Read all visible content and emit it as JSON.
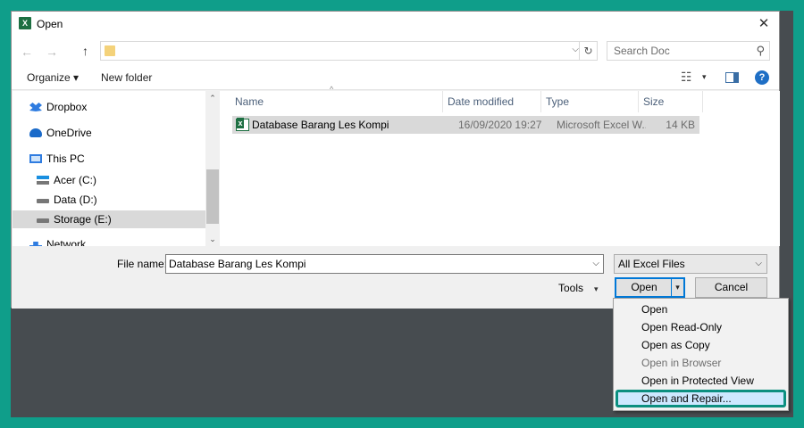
{
  "window": {
    "title": "Open",
    "app_icon": "X",
    "close": "✕"
  },
  "nav": {
    "back": "←",
    "forward": "→",
    "up": "↑",
    "address": "",
    "refresh": "↻",
    "dropdown": "⌵"
  },
  "search": {
    "placeholder": "Search Doc",
    "icon": "⚲"
  },
  "toolbar": {
    "organize": "Organize ▾",
    "new_folder": "New folder",
    "views": "☷",
    "views_caret": "▾",
    "help": "?"
  },
  "sidebar": {
    "items": [
      {
        "label": "Dropbox",
        "icon": "dropbox-icon"
      },
      {
        "label": "OneDrive",
        "icon": "onedrive-icon"
      },
      {
        "label": "This PC",
        "icon": "computer-icon"
      },
      {
        "label": "Acer (C:)",
        "icon": "windows-drive-icon"
      },
      {
        "label": "Data (D:)",
        "icon": "drive-icon"
      },
      {
        "label": "Storage (E:)",
        "icon": "drive-icon",
        "selected": true
      },
      {
        "label": "Network",
        "icon": "network-icon"
      }
    ]
  },
  "scrollbar": {
    "up": "⌃",
    "down": "⌄"
  },
  "columns": {
    "name": "Name",
    "date": "Date modified",
    "type": "Type",
    "size": "Size",
    "sort_caret": "^"
  },
  "files": [
    {
      "name": "Database Barang Les Kompi",
      "date": "16/09/2020 19:27",
      "type": "Microsoft Excel W...",
      "size": "14 KB"
    }
  ],
  "footer": {
    "file_name_label": "File name:",
    "file_name_value": "Database Barang Les Kompi",
    "filter": "All Excel Files",
    "tools": "Tools",
    "tools_caret": "▾",
    "open": "Open",
    "open_split": "▾",
    "cancel": "Cancel",
    "drop": "⌵"
  },
  "open_menu": {
    "items": [
      {
        "label": "Open",
        "enabled": true
      },
      {
        "label": "Open Read-Only",
        "enabled": true
      },
      {
        "label": "Open as Copy",
        "enabled": true
      },
      {
        "label": "Open in Browser",
        "enabled": false
      },
      {
        "label": "Open in Protected View",
        "enabled": true
      },
      {
        "label": "Open and Repair...",
        "enabled": true,
        "highlighted": true
      }
    ]
  },
  "colors": {
    "accent": "#0078d7",
    "highlight_border": "#0b8f80",
    "frame": "#0f9e8a",
    "excel": "#1d6f42"
  }
}
